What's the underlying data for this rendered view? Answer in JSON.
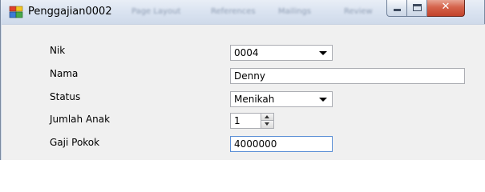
{
  "window": {
    "title": "Penggajian0002",
    "blurred_menu": [
      "Page Layout",
      "References",
      "Mailings",
      "Review"
    ],
    "icons": {
      "app": "form-app-icon",
      "minimize": "minimize-icon",
      "maximize": "maximize-icon",
      "close": "close-icon"
    },
    "close_glyph": "✕"
  },
  "form": {
    "nik": {
      "label": "Nik",
      "value": "0004"
    },
    "nama": {
      "label": "Nama",
      "value": "Denny"
    },
    "status": {
      "label": "Status",
      "value": "Menikah"
    },
    "jumlah_anak": {
      "label": "Jumlah Anak",
      "value": "1"
    },
    "gaji_pokok": {
      "label": "Gaji Pokok",
      "value": "4000000"
    }
  },
  "colors": {
    "titlebar": "#dbe4f1",
    "close_button": "#d5634b",
    "background": "#f0f0f0",
    "field_border": "#abadb3",
    "focus_border": "#5b8fd6"
  }
}
